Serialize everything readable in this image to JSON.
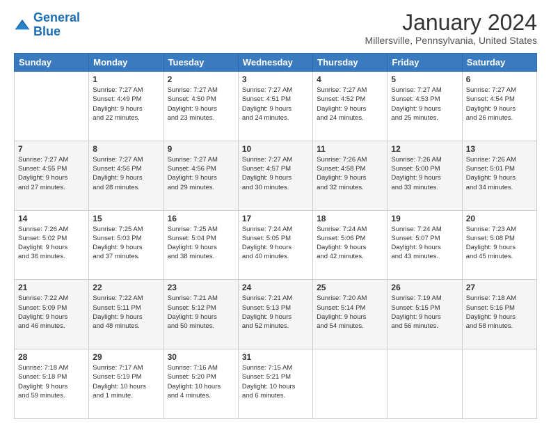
{
  "header": {
    "logo_line1": "General",
    "logo_line2": "Blue",
    "month": "January 2024",
    "location": "Millersville, Pennsylvania, United States"
  },
  "weekdays": [
    "Sunday",
    "Monday",
    "Tuesday",
    "Wednesday",
    "Thursday",
    "Friday",
    "Saturday"
  ],
  "weeks": [
    [
      {
        "day": "",
        "info": ""
      },
      {
        "day": "1",
        "info": "Sunrise: 7:27 AM\nSunset: 4:49 PM\nDaylight: 9 hours\nand 22 minutes."
      },
      {
        "day": "2",
        "info": "Sunrise: 7:27 AM\nSunset: 4:50 PM\nDaylight: 9 hours\nand 23 minutes."
      },
      {
        "day": "3",
        "info": "Sunrise: 7:27 AM\nSunset: 4:51 PM\nDaylight: 9 hours\nand 24 minutes."
      },
      {
        "day": "4",
        "info": "Sunrise: 7:27 AM\nSunset: 4:52 PM\nDaylight: 9 hours\nand 24 minutes."
      },
      {
        "day": "5",
        "info": "Sunrise: 7:27 AM\nSunset: 4:53 PM\nDaylight: 9 hours\nand 25 minutes."
      },
      {
        "day": "6",
        "info": "Sunrise: 7:27 AM\nSunset: 4:54 PM\nDaylight: 9 hours\nand 26 minutes."
      }
    ],
    [
      {
        "day": "7",
        "info": "Sunrise: 7:27 AM\nSunset: 4:55 PM\nDaylight: 9 hours\nand 27 minutes."
      },
      {
        "day": "8",
        "info": "Sunrise: 7:27 AM\nSunset: 4:56 PM\nDaylight: 9 hours\nand 28 minutes."
      },
      {
        "day": "9",
        "info": "Sunrise: 7:27 AM\nSunset: 4:56 PM\nDaylight: 9 hours\nand 29 minutes."
      },
      {
        "day": "10",
        "info": "Sunrise: 7:27 AM\nSunset: 4:57 PM\nDaylight: 9 hours\nand 30 minutes."
      },
      {
        "day": "11",
        "info": "Sunrise: 7:26 AM\nSunset: 4:58 PM\nDaylight: 9 hours\nand 32 minutes."
      },
      {
        "day": "12",
        "info": "Sunrise: 7:26 AM\nSunset: 5:00 PM\nDaylight: 9 hours\nand 33 minutes."
      },
      {
        "day": "13",
        "info": "Sunrise: 7:26 AM\nSunset: 5:01 PM\nDaylight: 9 hours\nand 34 minutes."
      }
    ],
    [
      {
        "day": "14",
        "info": "Sunrise: 7:26 AM\nSunset: 5:02 PM\nDaylight: 9 hours\nand 36 minutes."
      },
      {
        "day": "15",
        "info": "Sunrise: 7:25 AM\nSunset: 5:03 PM\nDaylight: 9 hours\nand 37 minutes."
      },
      {
        "day": "16",
        "info": "Sunrise: 7:25 AM\nSunset: 5:04 PM\nDaylight: 9 hours\nand 38 minutes."
      },
      {
        "day": "17",
        "info": "Sunrise: 7:24 AM\nSunset: 5:05 PM\nDaylight: 9 hours\nand 40 minutes."
      },
      {
        "day": "18",
        "info": "Sunrise: 7:24 AM\nSunset: 5:06 PM\nDaylight: 9 hours\nand 42 minutes."
      },
      {
        "day": "19",
        "info": "Sunrise: 7:24 AM\nSunset: 5:07 PM\nDaylight: 9 hours\nand 43 minutes."
      },
      {
        "day": "20",
        "info": "Sunrise: 7:23 AM\nSunset: 5:08 PM\nDaylight: 9 hours\nand 45 minutes."
      }
    ],
    [
      {
        "day": "21",
        "info": "Sunrise: 7:22 AM\nSunset: 5:09 PM\nDaylight: 9 hours\nand 46 minutes."
      },
      {
        "day": "22",
        "info": "Sunrise: 7:22 AM\nSunset: 5:11 PM\nDaylight: 9 hours\nand 48 minutes."
      },
      {
        "day": "23",
        "info": "Sunrise: 7:21 AM\nSunset: 5:12 PM\nDaylight: 9 hours\nand 50 minutes."
      },
      {
        "day": "24",
        "info": "Sunrise: 7:21 AM\nSunset: 5:13 PM\nDaylight: 9 hours\nand 52 minutes."
      },
      {
        "day": "25",
        "info": "Sunrise: 7:20 AM\nSunset: 5:14 PM\nDaylight: 9 hours\nand 54 minutes."
      },
      {
        "day": "26",
        "info": "Sunrise: 7:19 AM\nSunset: 5:15 PM\nDaylight: 9 hours\nand 56 minutes."
      },
      {
        "day": "27",
        "info": "Sunrise: 7:18 AM\nSunset: 5:16 PM\nDaylight: 9 hours\nand 58 minutes."
      }
    ],
    [
      {
        "day": "28",
        "info": "Sunrise: 7:18 AM\nSunset: 5:18 PM\nDaylight: 9 hours\nand 59 minutes."
      },
      {
        "day": "29",
        "info": "Sunrise: 7:17 AM\nSunset: 5:19 PM\nDaylight: 10 hours\nand 1 minute."
      },
      {
        "day": "30",
        "info": "Sunrise: 7:16 AM\nSunset: 5:20 PM\nDaylight: 10 hours\nand 4 minutes."
      },
      {
        "day": "31",
        "info": "Sunrise: 7:15 AM\nSunset: 5:21 PM\nDaylight: 10 hours\nand 6 minutes."
      },
      {
        "day": "",
        "info": ""
      },
      {
        "day": "",
        "info": ""
      },
      {
        "day": "",
        "info": ""
      }
    ]
  ]
}
